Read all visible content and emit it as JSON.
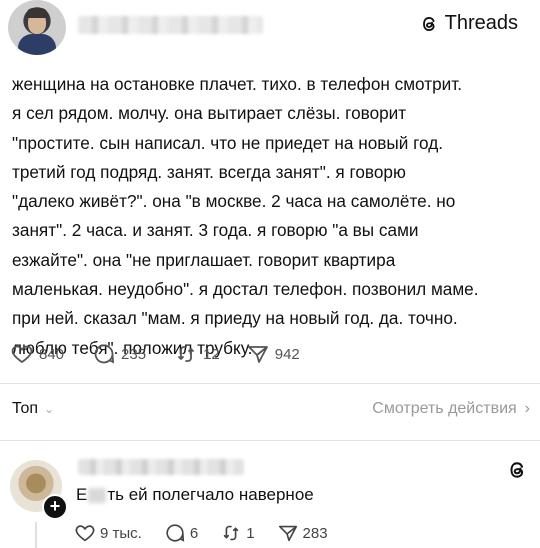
{
  "header": {
    "brand_label": "Threads",
    "avatar_icon": "profile-photo",
    "brand_icon": "threads-logo-icon"
  },
  "post": {
    "text": "женщина на остановке плачет. тихо. в телефон смотрит.\nя сел рядом. молчу. она вытирает слёзы. говорит\n\"простите. сын написал. что не приедет на новый год.\nтретий год подряд. занят. всегда занят\". я говорю\n\"далеко живёт?\". она \"в москве. 2 часа на самолёте. но\nзанят\". 2 часа. и занят. 3 года. я говорю \"а вы сами\nезжайте\". она \"не приглашает. говорит квартира\nмаленькая. неудобно\". я достал телефон. позвонил маме.\nпри ней. сказал \"мам. я приеду на новый год. да. точно.\nлюблю тебя\". положил трубку.",
    "likes": "840",
    "replies": "235",
    "reposts": "12",
    "shares": "942"
  },
  "sort": {
    "label": "Топ",
    "view_actions": "Смотреть действия"
  },
  "comment": {
    "text_start": "Е",
    "text_end": "ть ей полегчало наверное",
    "likes": "9 тыс.",
    "replies": "6",
    "reposts": "1",
    "shares": "283"
  },
  "colors": {
    "text": "#111111",
    "muted": "#555555",
    "divider": "#e2e2e2",
    "link_muted": "#999999"
  }
}
